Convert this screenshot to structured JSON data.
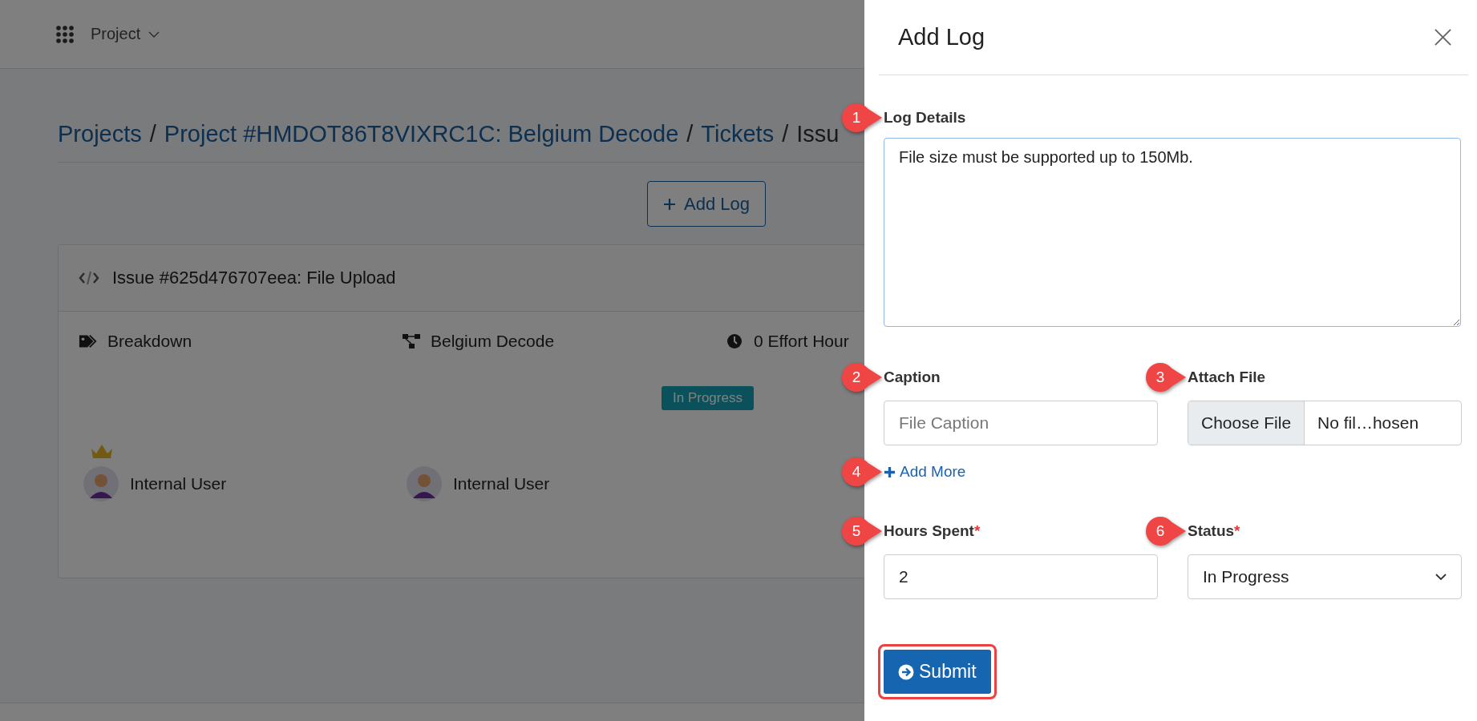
{
  "topbar": {
    "menu_label": "Project"
  },
  "breadcrumb": [
    {
      "label": "Projects",
      "link": true
    },
    {
      "separator": "/",
      "label": "Project #HMDOT86T8VIXRC1C: Belgium Decode",
      "link": true
    },
    {
      "separator": "/",
      "label": "Tickets",
      "link": true
    },
    {
      "separator": "/",
      "label": "Issu",
      "link": false
    }
  ],
  "add_log_button": {
    "label": "Add Log"
  },
  "issue_card": {
    "title": "Issue #625d476707eea: File Upload",
    "meta": [
      {
        "kind": "tag",
        "label": "Breakdown"
      },
      {
        "kind": "project",
        "label": "Belgium Decode"
      },
      {
        "kind": "time",
        "label": "0 Effort Hour"
      }
    ],
    "status_badge": "In Progress",
    "users": [
      {
        "name": "Internal User",
        "owner": true
      },
      {
        "name": "Internal User",
        "owner": false
      }
    ]
  },
  "drawer": {
    "title": "Add Log",
    "log_details": {
      "label": "Log Details",
      "callout": "1",
      "value": "File size must be supported up to 150Mb."
    },
    "caption": {
      "label": "Caption",
      "callout": "2",
      "placeholder": "File Caption"
    },
    "attach_file": {
      "label": "Attach File",
      "callout": "3",
      "button": "Choose File",
      "file_name": "No fil…hosen"
    },
    "add_more": {
      "label": "Add More",
      "callout": "4"
    },
    "hours_spent": {
      "label": "Hours Spent",
      "required_mark": "*",
      "callout": "5",
      "value": "2"
    },
    "status": {
      "label": "Status",
      "required_mark": "*",
      "callout": "6",
      "value": "In Progress"
    },
    "submit": {
      "label": "Submit",
      "highlighted": true
    }
  }
}
